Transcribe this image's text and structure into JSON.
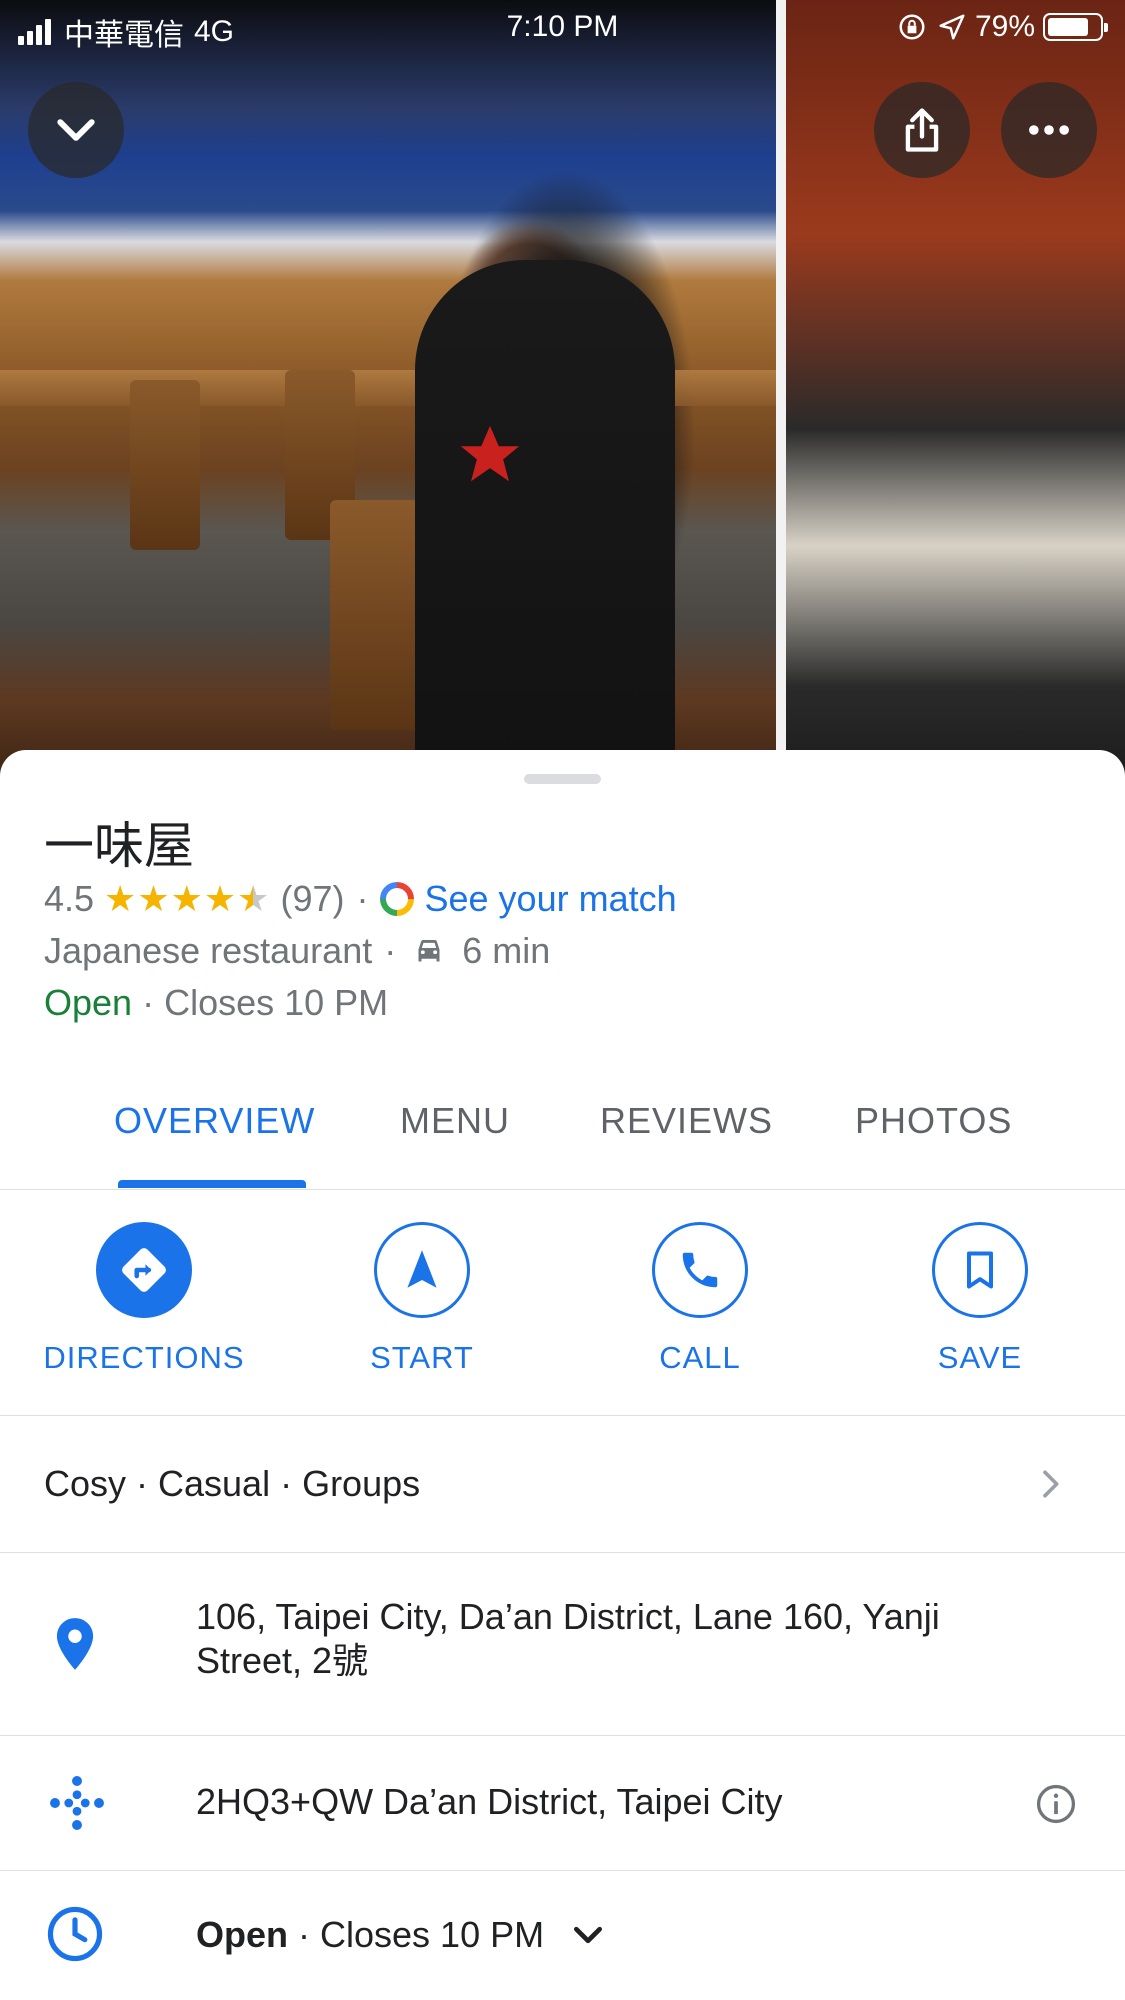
{
  "status_bar": {
    "carrier": "中華電信",
    "network": "4G",
    "time": "7:10 PM",
    "battery": "79%",
    "battery_level": 0.79
  },
  "header": {
    "collapse_icon": "chevron-down-icon",
    "share_icon": "share-icon",
    "more_icon": "more-horizontal-icon"
  },
  "place": {
    "name": "一味屋",
    "rating": "4.5",
    "rating_value": 4.5,
    "reviews_count": "(97)",
    "sep": "·",
    "match_link": "See your match",
    "category": "Japanese restaurant",
    "drive_time": "6 min",
    "open_status": "Open",
    "closes": "Closes 10 PM"
  },
  "tabs": [
    "OVERVIEW",
    "MENU",
    "REVIEWS",
    "PHOTOS"
  ],
  "actions": {
    "directions": "DIRECTIONS",
    "start": "START",
    "call": "CALL",
    "save": "SAVE"
  },
  "details": {
    "attributes": "Cosy · Casual · Groups",
    "address": "106, Taipei City, Da’an District, Lane 160, Yanji Street, 2號",
    "plus_code": "2HQ3+QW Da’an District, Taipei City",
    "hours_open": "Open",
    "hours_closes": " · Closes 10 PM"
  },
  "colors": {
    "accent": "#1a73e8",
    "open_green": "#188038",
    "star": "#f5b400"
  }
}
